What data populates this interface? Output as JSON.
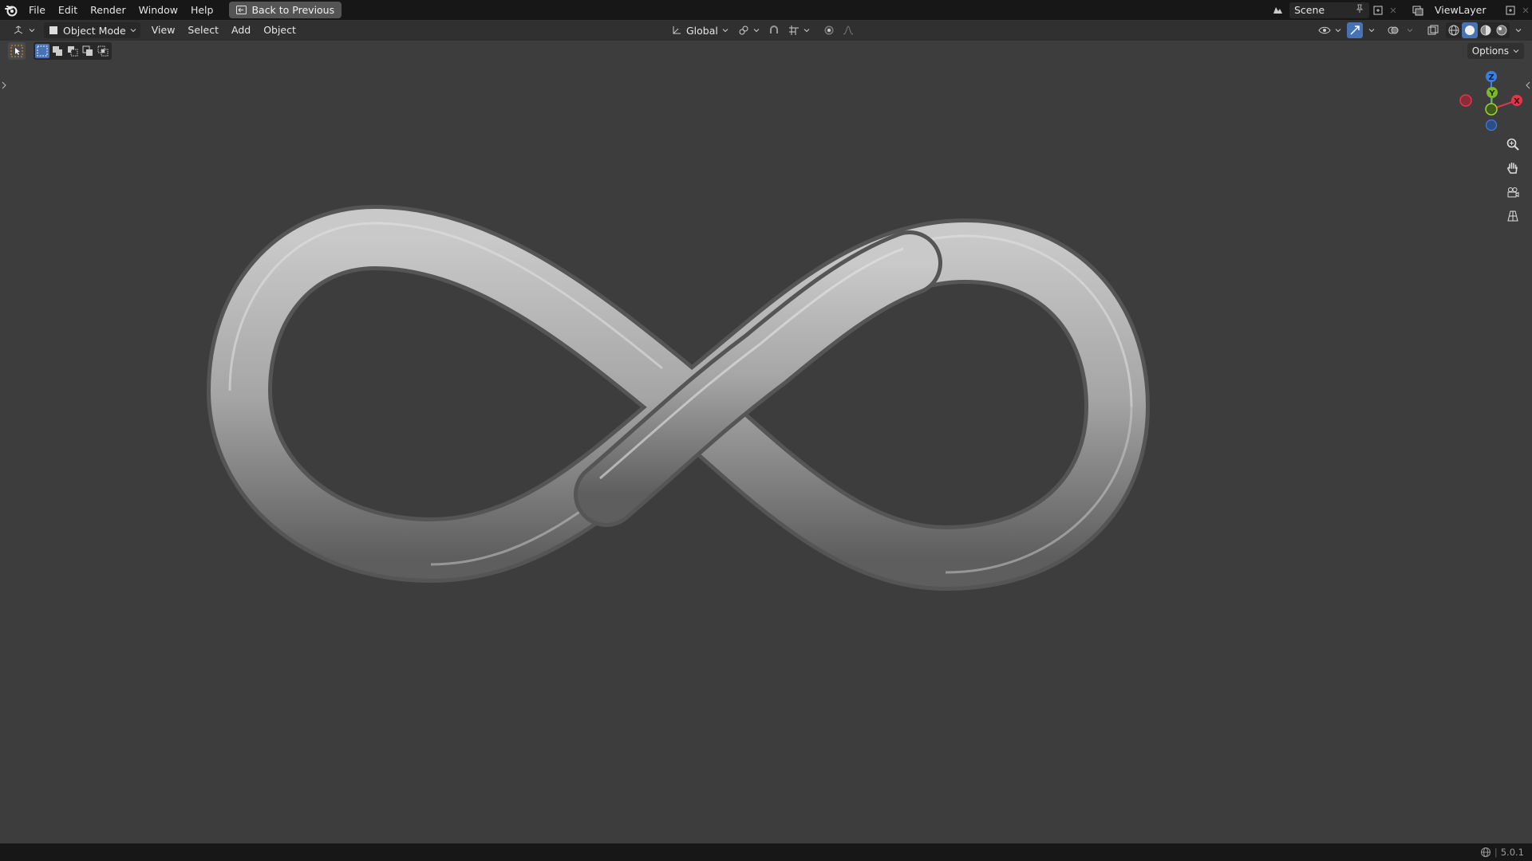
{
  "topbar": {
    "menus": [
      "File",
      "Edit",
      "Render",
      "Window",
      "Help"
    ],
    "back_button": "Back to Previous",
    "scene_name": "Scene",
    "view_layer_name": "ViewLayer"
  },
  "viewport_header": {
    "mode": "Object Mode",
    "menus": [
      "View",
      "Select",
      "Add",
      "Object"
    ],
    "transform_orientation": "Global"
  },
  "tool_header": {
    "options_label": "Options"
  },
  "gizmo": {
    "axes": [
      "Z",
      "Y",
      "X"
    ]
  },
  "statusbar": {
    "version": "5.0.1"
  },
  "colors": {
    "accent": "#4772b3",
    "axis_x": "#e5344b",
    "axis_y": "#7db72a",
    "axis_z": "#3b7fe0",
    "background": "#3d3d3d"
  }
}
